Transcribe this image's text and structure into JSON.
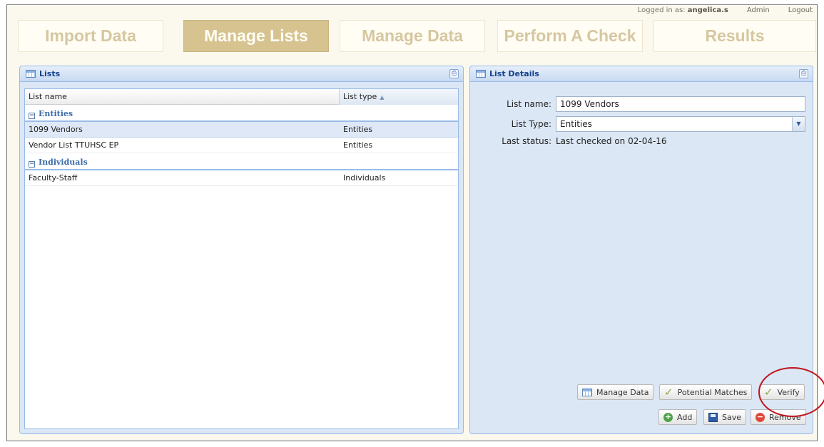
{
  "user_bar": {
    "logged_in_prefix": "Logged in as:",
    "username": "angelica.s",
    "admin_link": "Admin",
    "logout_link": "Logout"
  },
  "tabs": [
    {
      "label": "Import Data",
      "active": false
    },
    {
      "label": "Manage Lists",
      "active": true
    },
    {
      "label": "Manage Data",
      "active": false
    },
    {
      "label": "Perform A Check",
      "active": false
    },
    {
      "label": "Results",
      "active": false
    }
  ],
  "lists_panel": {
    "title": "Lists",
    "columns": {
      "name": "List name",
      "type": "List type"
    },
    "groups": [
      {
        "label": "Entities",
        "rows": [
          {
            "name": "1099 Vendors",
            "type": "Entities",
            "selected": true
          },
          {
            "name": "Vendor List TTUHSC EP",
            "type": "Entities",
            "selected": false
          }
        ]
      },
      {
        "label": "Individuals",
        "rows": [
          {
            "name": "Faculty-Staff",
            "type": "Individuals",
            "selected": false
          }
        ]
      }
    ]
  },
  "details_panel": {
    "title": "List Details",
    "list_name_label": "List name:",
    "list_name_value": "1099 Vendors",
    "list_type_label": "List Type:",
    "list_type_value": "Entities",
    "last_status_label": "Last status:",
    "last_status_value": "Last checked on 02-04-16",
    "buttons": {
      "manage_data": "Manage Data",
      "potential_matches": "Potential Matches",
      "verify": "Verify",
      "add": "Add",
      "save": "Save",
      "remove": "Remove"
    }
  },
  "colors": {
    "active_tab": "#d7c38f",
    "panel_bg": "#dbe7f5",
    "panel_title": "#15428b",
    "annotation_ring": "#c0141b"
  }
}
